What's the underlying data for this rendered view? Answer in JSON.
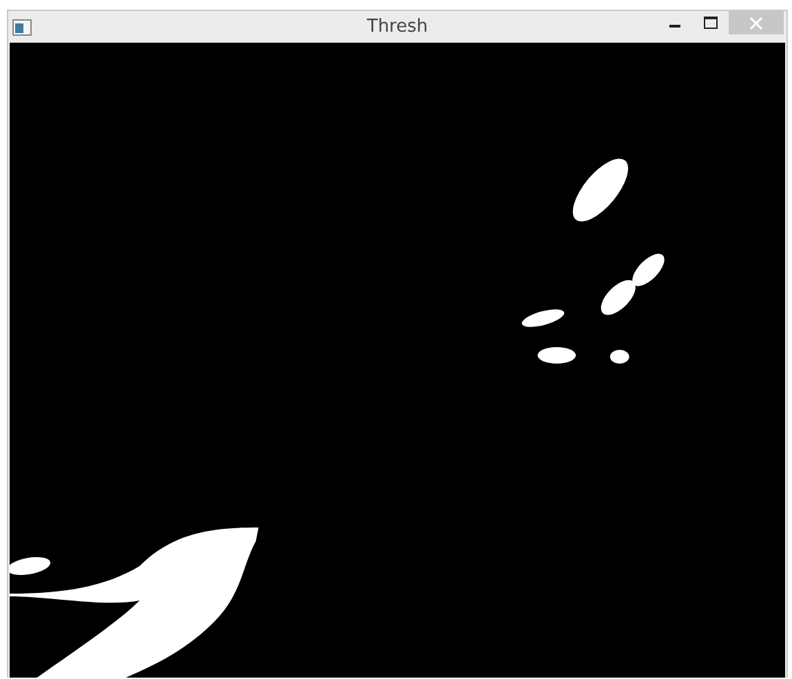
{
  "window": {
    "title": "Thresh"
  }
}
